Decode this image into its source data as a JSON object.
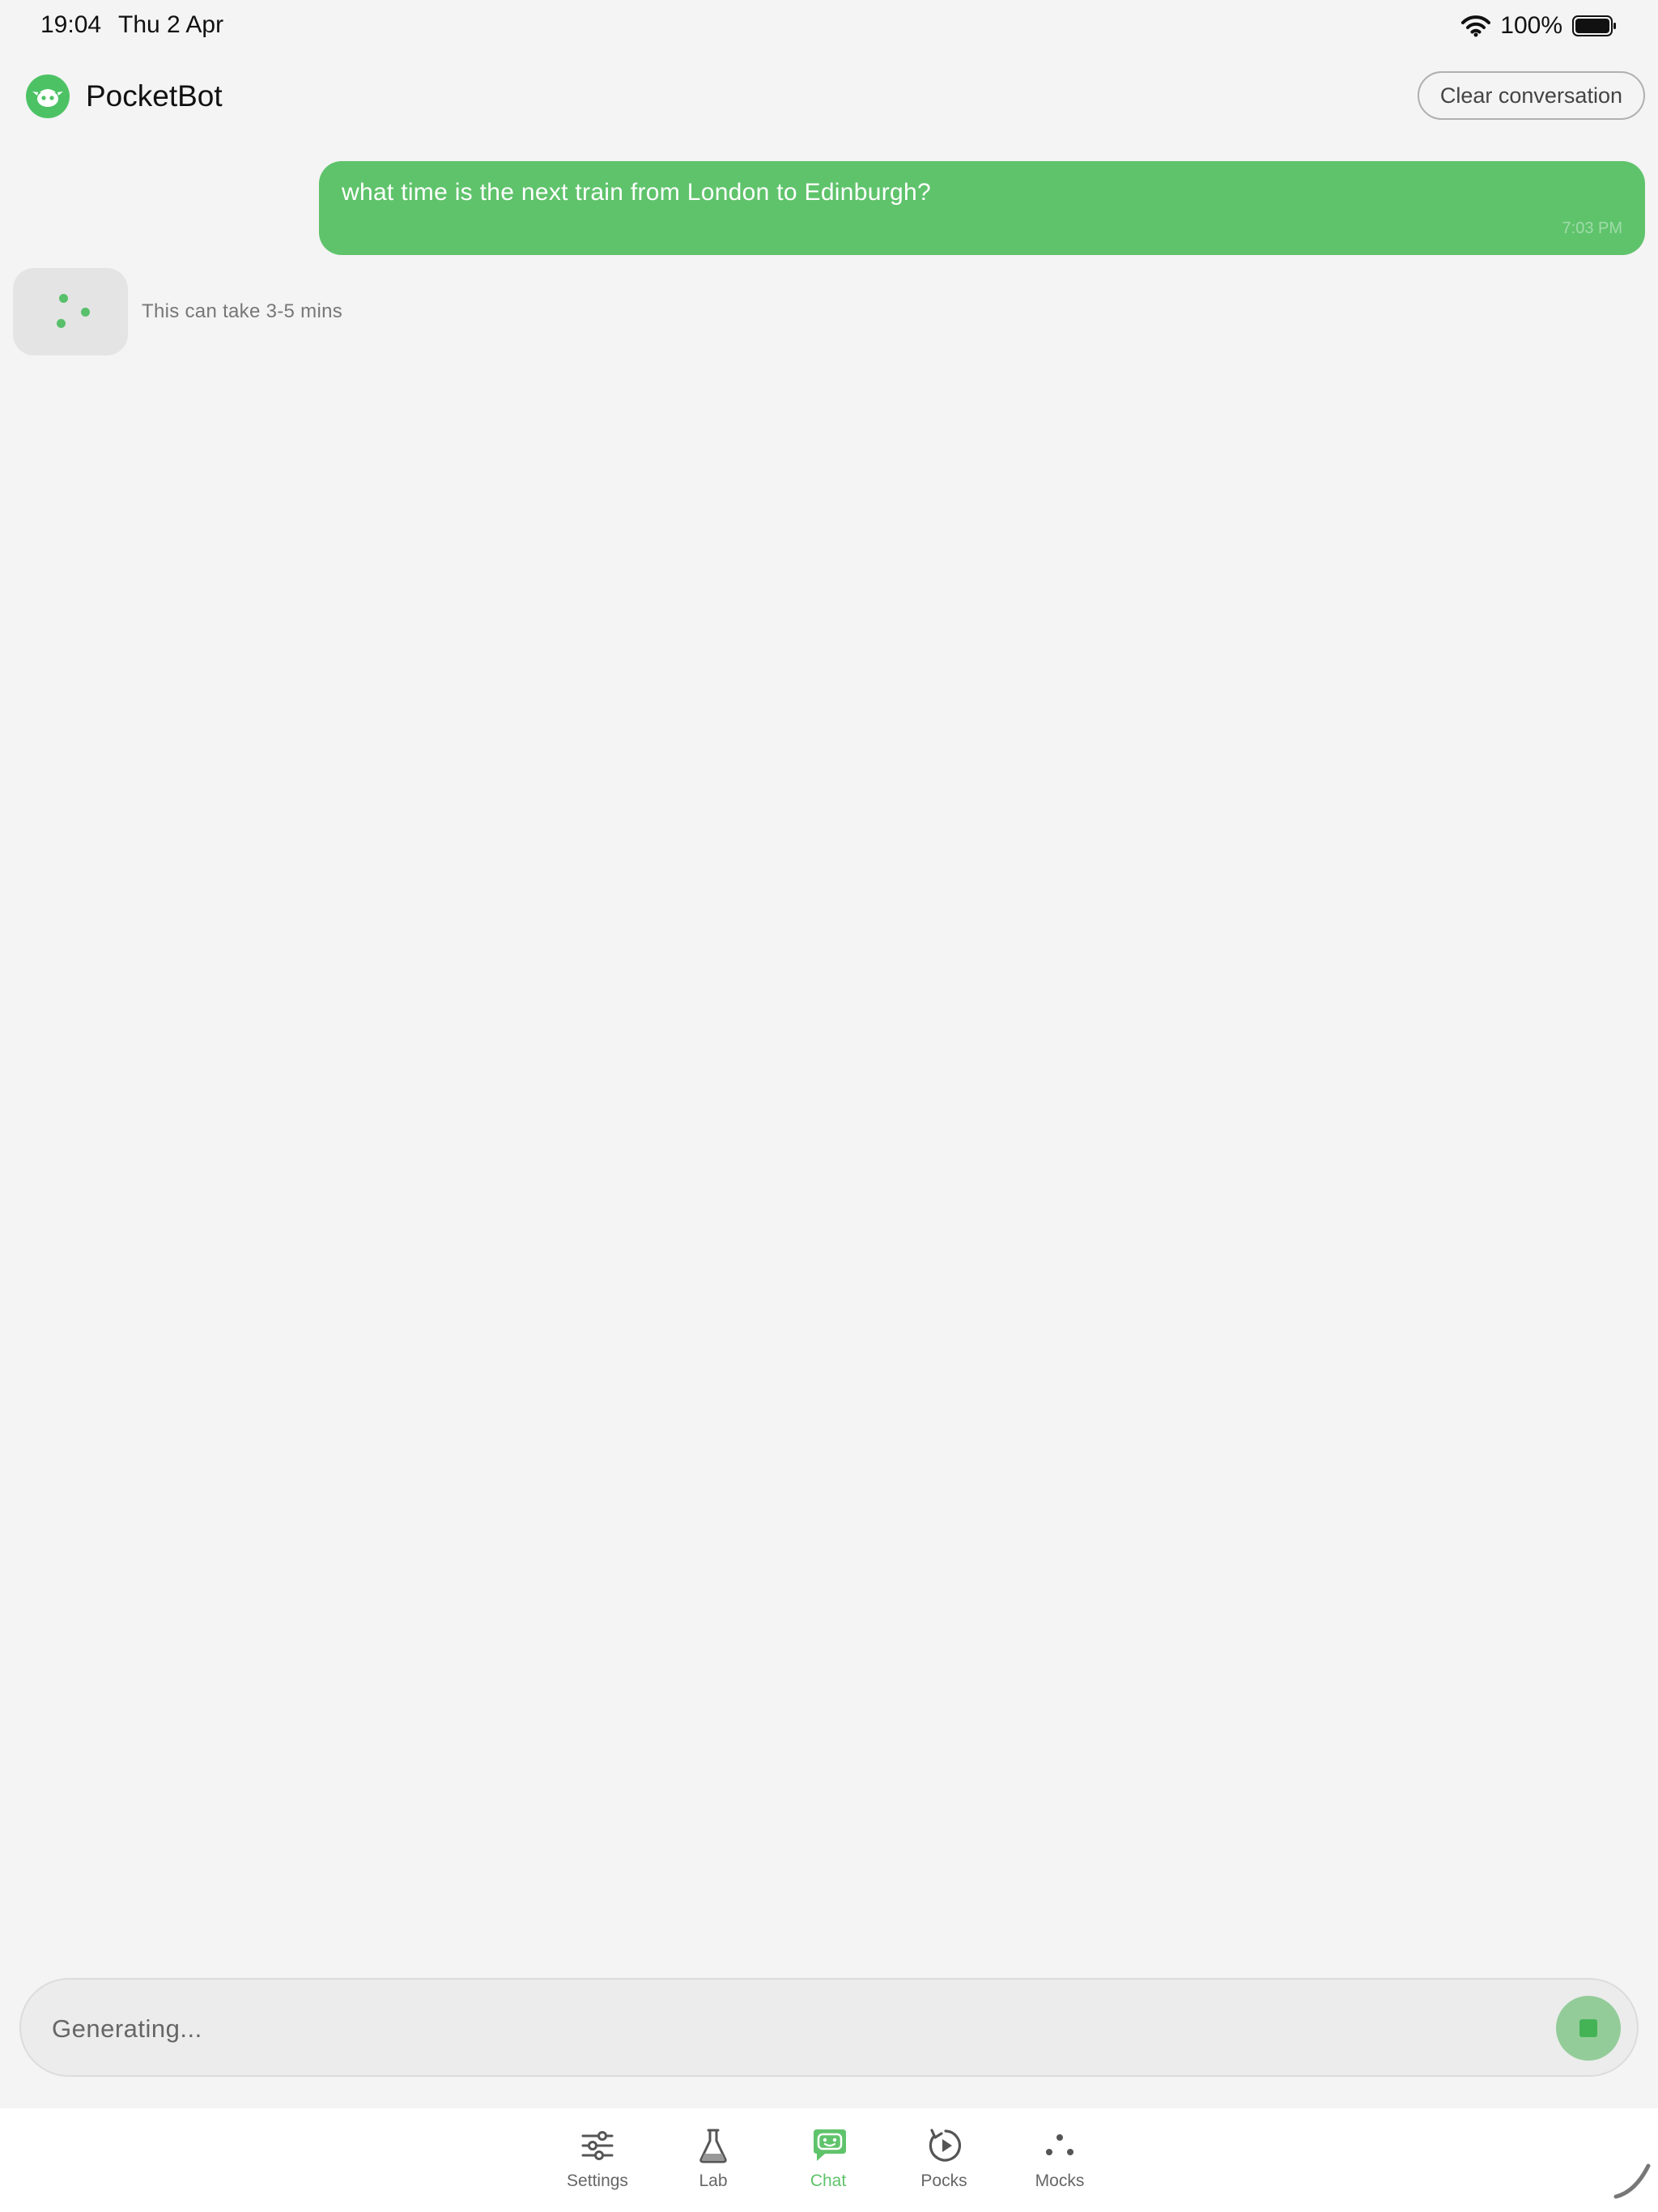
{
  "status_bar": {
    "time": "19:04",
    "date": "Thu 2 Apr",
    "battery": "100%"
  },
  "header": {
    "app_name": "PocketBot",
    "clear_label": "Clear conversation"
  },
  "conversation": {
    "user_message": {
      "text": "what time is the next train from London to Edinburgh?",
      "time": "7:03 PM"
    },
    "bot_status": "This can take 3-5 mins"
  },
  "composer": {
    "placeholder": "Generating..."
  },
  "tabs": [
    {
      "label": "Settings",
      "icon": "sliders-icon"
    },
    {
      "label": "Lab",
      "icon": "flask-icon"
    },
    {
      "label": "Chat",
      "icon": "chat-bot-icon",
      "active": true
    },
    {
      "label": "Pocks",
      "icon": "replay-icon"
    },
    {
      "label": "Mocks",
      "icon": "three-dots-icon"
    }
  ],
  "colors": {
    "accent": "#5fc36b",
    "background": "#f4f4f4",
    "bubble_bot": "#e4e4e4"
  }
}
